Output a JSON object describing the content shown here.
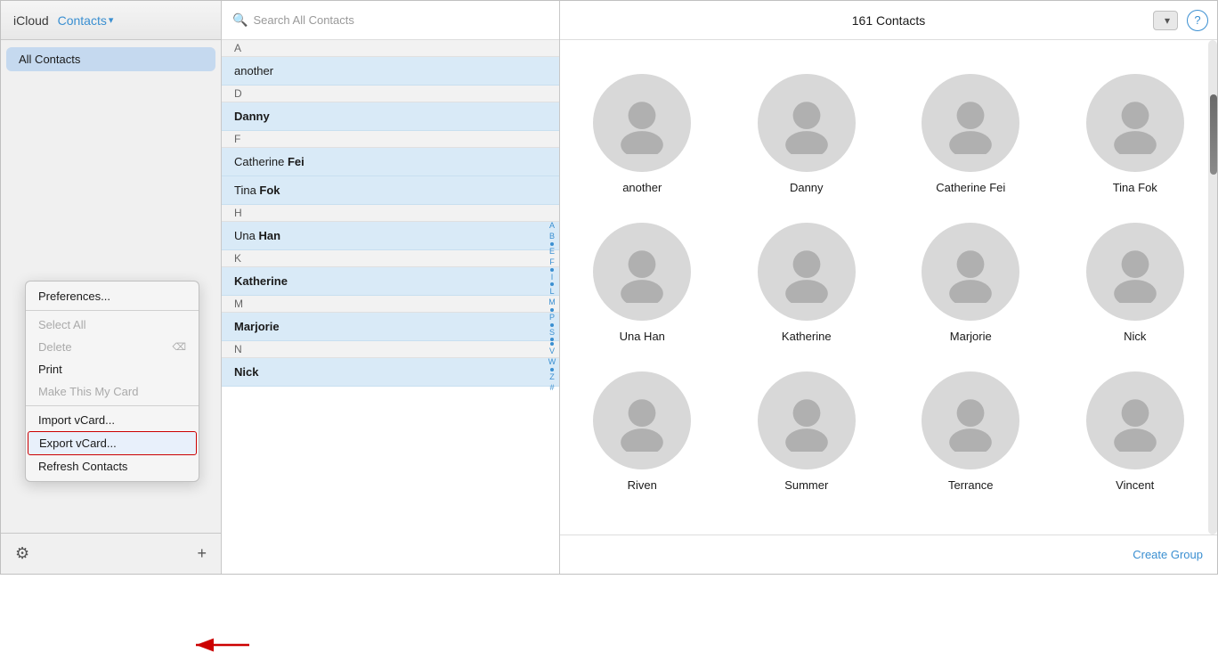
{
  "sidebar": {
    "icloud_label": "iCloud",
    "contacts_label": "Contacts",
    "nav_items": [
      {
        "label": "All Contacts",
        "active": true
      }
    ],
    "gear_icon": "⚙",
    "plus_icon": "+"
  },
  "context_menu": {
    "items": [
      {
        "label": "Preferences...",
        "disabled": false,
        "shortcut": ""
      },
      {
        "label": "Select All",
        "disabled": false,
        "shortcut": ""
      },
      {
        "label": "Delete",
        "disabled": false,
        "shortcut": "⌫"
      },
      {
        "label": "Print",
        "disabled": false,
        "shortcut": ""
      },
      {
        "label": "Make This My Card",
        "disabled": false,
        "shortcut": ""
      },
      {
        "label": "Import vCard...",
        "disabled": false,
        "shortcut": ""
      },
      {
        "label": "Export vCard...",
        "disabled": false,
        "shortcut": "",
        "highlighted": true
      },
      {
        "label": "Refresh Contacts",
        "disabled": false,
        "shortcut": ""
      }
    ]
  },
  "search": {
    "placeholder": "Search All Contacts"
  },
  "header": {
    "count_label": "161 Contacts",
    "help_label": "?"
  },
  "contact_list": {
    "sections": [
      {
        "letter": "A",
        "contacts": [
          {
            "first": "",
            "last": "another"
          }
        ]
      },
      {
        "letter": "D",
        "contacts": [
          {
            "first": "",
            "last": "Danny"
          }
        ]
      },
      {
        "letter": "F",
        "contacts": [
          {
            "first": "Catherine ",
            "last": "Fei"
          },
          {
            "first": "Tina ",
            "last": "Fok"
          }
        ]
      },
      {
        "letter": "H",
        "contacts": [
          {
            "first": "Una ",
            "last": "Han"
          }
        ]
      },
      {
        "letter": "K",
        "contacts": [
          {
            "first": "",
            "last": "Katherine"
          }
        ]
      },
      {
        "letter": "M",
        "contacts": [
          {
            "first": "",
            "last": "Marjorie"
          }
        ]
      },
      {
        "letter": "N",
        "contacts": [
          {
            "first": "",
            "last": "Nick"
          }
        ]
      }
    ],
    "alphabet": [
      "A",
      "B",
      "•",
      "E",
      "F",
      "•",
      "I",
      "•",
      "L",
      "M",
      "•",
      "P",
      "•",
      "S",
      "•",
      "•",
      "V",
      "W",
      "•",
      "Z",
      "#"
    ]
  },
  "cards": [
    {
      "name": "another"
    },
    {
      "name": "Danny"
    },
    {
      "name": "Catherine Fei"
    },
    {
      "name": "Tina Fok"
    },
    {
      "name": "Una Han"
    },
    {
      "name": "Katherine"
    },
    {
      "name": "Marjorie"
    },
    {
      "name": "Nick"
    },
    {
      "name": "Riven"
    },
    {
      "name": "Summer"
    },
    {
      "name": "Terrance"
    },
    {
      "name": "Vincent"
    }
  ],
  "footer": {
    "create_group_label": "Create Group"
  }
}
